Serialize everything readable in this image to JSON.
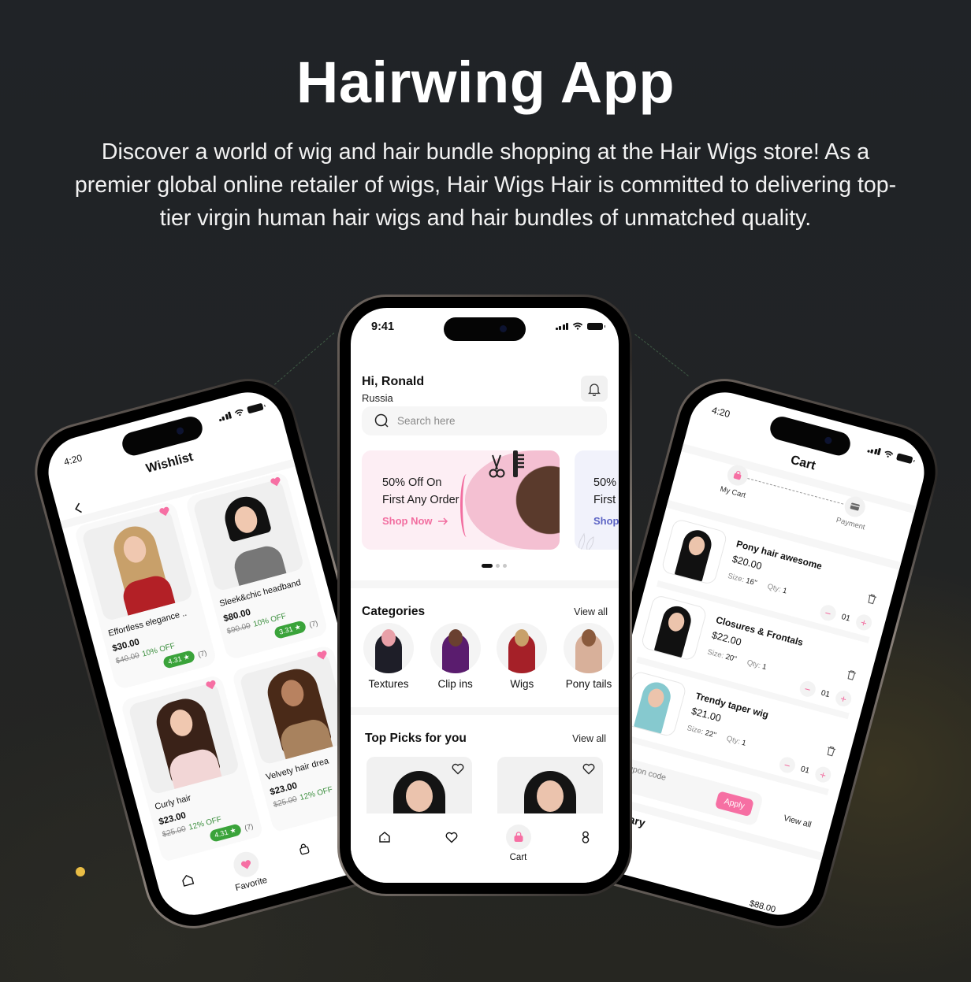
{
  "hero": {
    "title": "Hairwing App",
    "description": "Discover a world of wig and hair bundle shopping at the Hair Wigs store! As a premier global online retailer of wigs, Hair Wigs Hair is committed to delivering top-tier virgin human hair wigs and hair bundles of unmatched quality."
  },
  "colors": {
    "accent_pink": "#f26ea0",
    "accent_blue": "#5b63c4",
    "rating_green": "#3aa33a",
    "dot_yellow": "#e9bd45",
    "background": "#212325"
  },
  "home": {
    "status_time": "9:41",
    "greeting": "Hi, Ronald",
    "location": "Russia",
    "search_placeholder": "Search here",
    "banners": [
      {
        "line1": "50% Off On",
        "line2": "First Any Order",
        "cta": "Shop Now"
      },
      {
        "line1": "50%",
        "line2": "First",
        "cta": "Shop"
      }
    ],
    "carousel": {
      "total": 3,
      "active": 1
    },
    "categories": {
      "title": "Categories",
      "view_all": "View all",
      "items": [
        {
          "label": "Textures"
        },
        {
          "label": "Clip ins"
        },
        {
          "label": "Wigs"
        },
        {
          "label": "Pony tails"
        }
      ]
    },
    "top_picks": {
      "title": "Top Picks for you",
      "view_all": "View all"
    },
    "nav": {
      "cart_label": "Cart"
    }
  },
  "wishlist": {
    "status_time": "4:20",
    "title": "Wishlist",
    "items": [
      {
        "name": "Effortless elegance ..",
        "price": "$30.00",
        "old_price": "$40.00",
        "discount": "10% OFF",
        "rating": "4.31",
        "reviews": "(7)"
      },
      {
        "name": "Sleek&chic headband",
        "price": "$80.00",
        "old_price": "$90.00",
        "discount": "10% OFF",
        "rating": "3.31",
        "reviews": "(7)"
      },
      {
        "name": "Curly hair",
        "price": "$23.00",
        "old_price": "$25.00",
        "discount": "12% OFF",
        "rating": "4.31",
        "reviews": "(7)"
      },
      {
        "name": "Velvety hair drea",
        "price": "$23.00",
        "old_price": "$25.00",
        "discount": "12% OFF"
      }
    ],
    "nav": {
      "favorite_label": "Favorite"
    }
  },
  "cart": {
    "status_time": "4:20",
    "title": "Cart",
    "steps": [
      {
        "label": "My Cart"
      },
      {
        "label": "Payment"
      }
    ],
    "items": [
      {
        "name": "Pony hair awesome",
        "price": "$20.00",
        "size_label": "Size:",
        "size": "16''",
        "qty_label": "Qty:",
        "qty": "1",
        "count": "01"
      },
      {
        "name": "Closures & Frontals",
        "price": "$22.00",
        "size_label": "Size:",
        "size": "20''",
        "qty_label": "Qty:",
        "qty": "1",
        "count": "01"
      },
      {
        "name": "Trendy taper wig",
        "price": "$21.00",
        "size_label": "Size:",
        "size": "22''",
        "qty_label": "Qty:",
        "qty": "1",
        "count": "01"
      }
    ],
    "coupon_placeholder": "Coupon code",
    "apply_label": "Apply",
    "view_all": "View all",
    "summary_title": "Summary",
    "total": "$88.00"
  }
}
